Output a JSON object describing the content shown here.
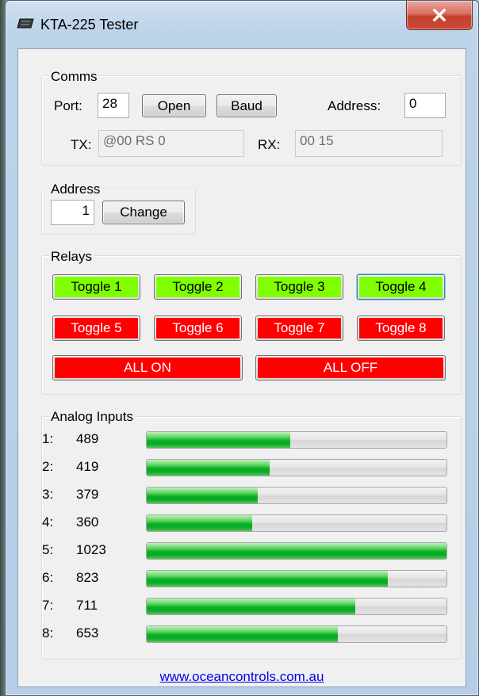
{
  "window": {
    "title": "KTA-225 Tester"
  },
  "comms": {
    "legend": "Comms",
    "port_label": "Port:",
    "port_value": "28",
    "open_label": "Open",
    "baud_label": "Baud",
    "address_label": "Address:",
    "address_value": "0",
    "tx_label": "TX:",
    "tx_value": "@00 RS 0",
    "rx_label": "RX:",
    "rx_value": "00 15"
  },
  "address": {
    "legend": "Address",
    "value": "1",
    "change_label": "Change"
  },
  "relays": {
    "legend": "Relays",
    "toggles": [
      {
        "label": "Toggle 1",
        "state": "on"
      },
      {
        "label": "Toggle 2",
        "state": "on"
      },
      {
        "label": "Toggle 3",
        "state": "on"
      },
      {
        "label": "Toggle 4",
        "state": "on"
      },
      {
        "label": "Toggle 5",
        "state": "off"
      },
      {
        "label": "Toggle 6",
        "state": "off"
      },
      {
        "label": "Toggle 7",
        "state": "off"
      },
      {
        "label": "Toggle 8",
        "state": "off"
      }
    ],
    "all_on_label": "ALL ON",
    "all_off_label": "ALL OFF"
  },
  "analog": {
    "legend": "Analog Inputs",
    "max": 1023,
    "inputs": [
      {
        "index": "1:",
        "value": "489",
        "level": 489
      },
      {
        "index": "2:",
        "value": "419",
        "level": 419
      },
      {
        "index": "3:",
        "value": "379",
        "level": 379
      },
      {
        "index": "4:",
        "value": "360",
        "level": 360
      },
      {
        "index": "5:",
        "value": "1023",
        "level": 1023
      },
      {
        "index": "6:",
        "value": "823",
        "level": 823
      },
      {
        "index": "7:",
        "value": "711",
        "level": 711
      },
      {
        "index": "8:",
        "value": "653",
        "level": 653
      }
    ]
  },
  "footer": {
    "link": "www.oceancontrols.com.au"
  },
  "icons": {
    "app": "chip-icon",
    "close": "close-icon"
  },
  "colors": {
    "relay_on": "#7fff00",
    "relay_off": "#ff0000",
    "progress": "#06b025",
    "link": "#0000ee"
  }
}
